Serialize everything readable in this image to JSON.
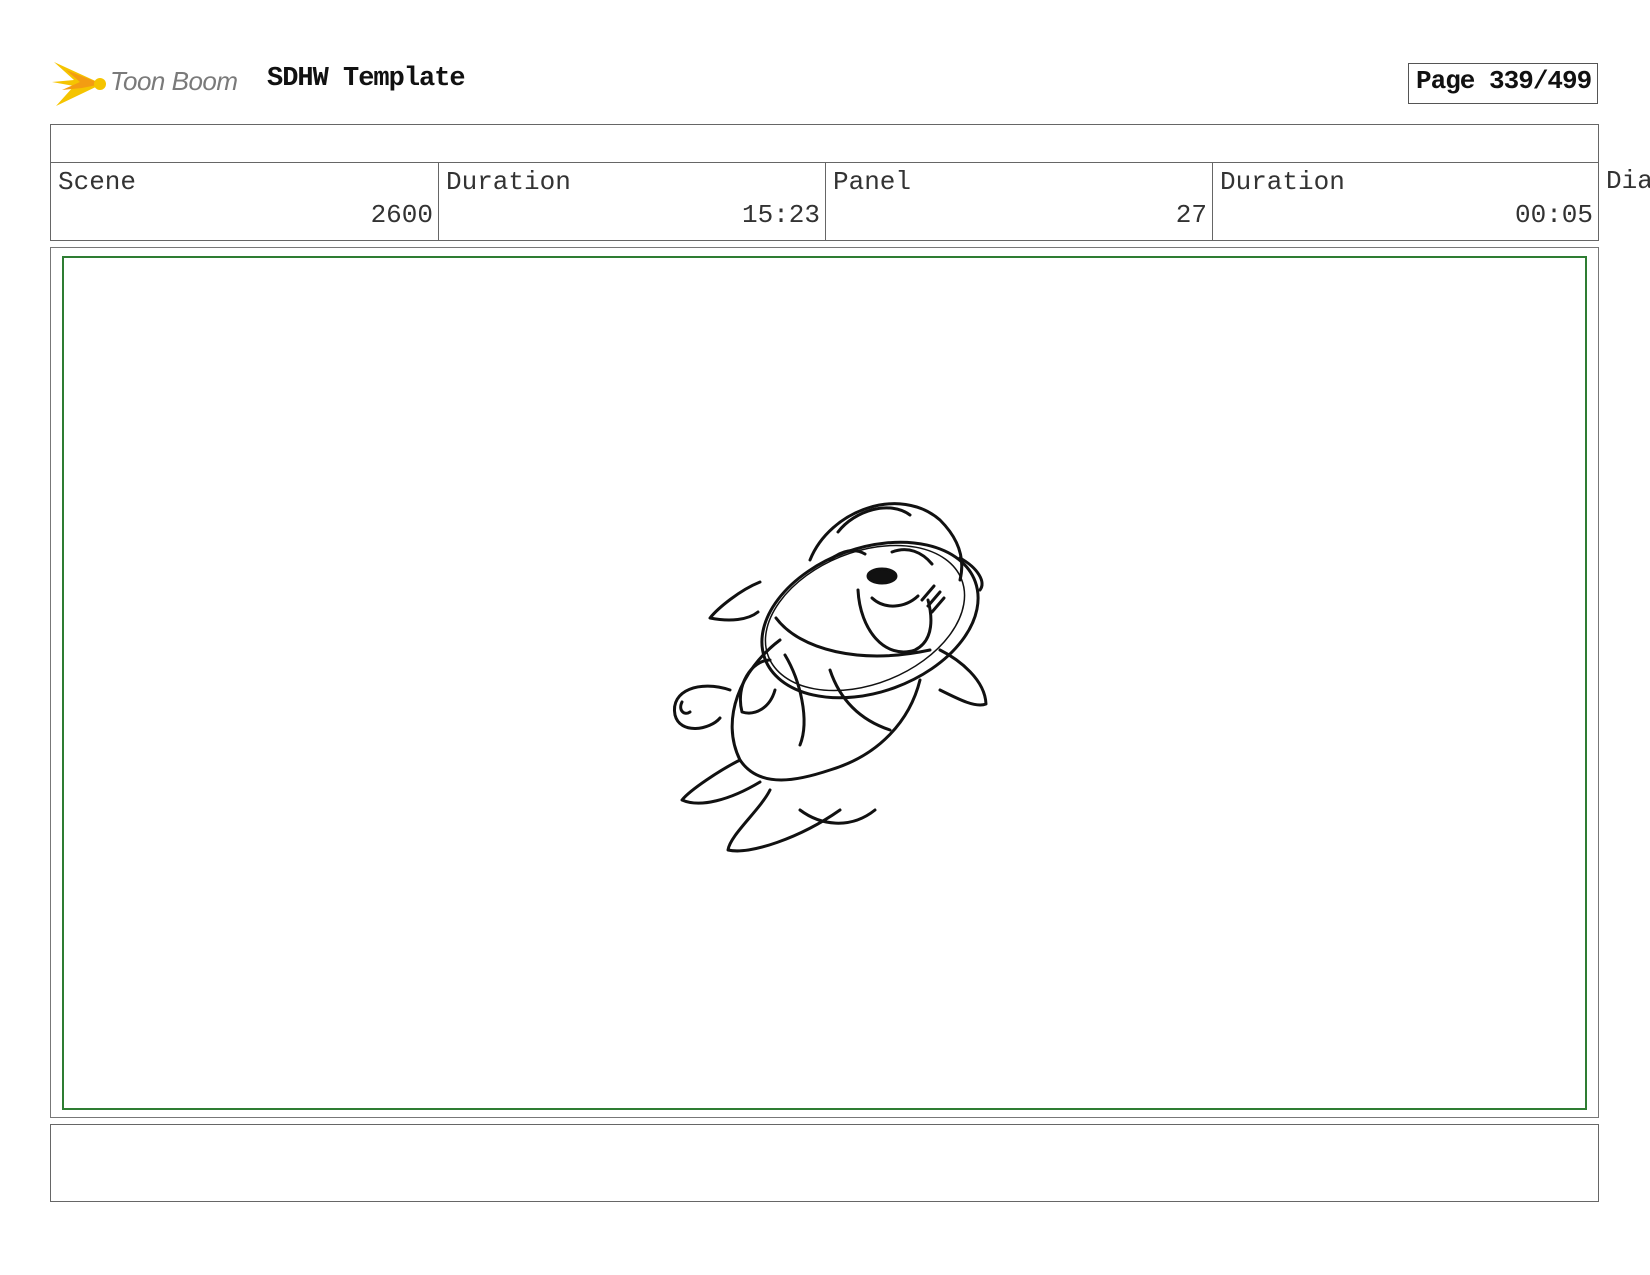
{
  "header": {
    "logo_text": "Toon Boom",
    "title": "SDHW Template",
    "page_label": "Page 339/499"
  },
  "info": {
    "scene_label": "Scene",
    "scene_value": "2600",
    "scene_duration_label": "Duration",
    "scene_duration_value": "15:23",
    "panel_label": "Panel",
    "panel_value": "27",
    "panel_duration_label": "Duration",
    "panel_duration_value": "00:05",
    "dialogue_label_partial": "Dia"
  },
  "colors": {
    "panel_border": "#2e7d32",
    "logo_yellow": "#f5c400",
    "logo_orange": "#f39c12"
  },
  "panel": {
    "sketch_icon": "chipmunk-sketch"
  }
}
